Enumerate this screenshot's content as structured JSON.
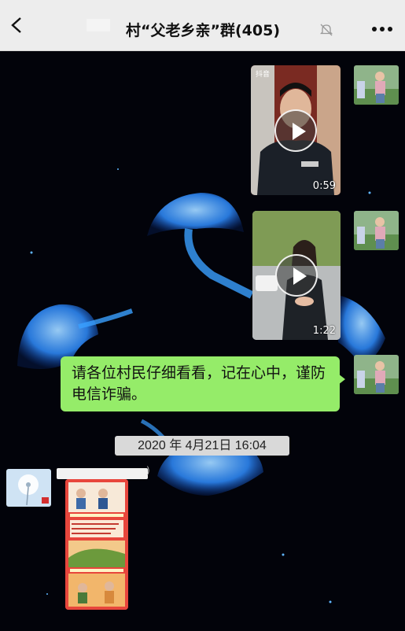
{
  "header": {
    "title": "村“父老乡亲”群(405)",
    "back_icon": "chevron-left-icon",
    "mute_icon": "bell-off-icon",
    "more_icon": "more-dots-icon"
  },
  "messages": {
    "video_1": {
      "duration": "0:59",
      "watermark": "抖音"
    },
    "video_2": {
      "duration": "1:22"
    },
    "text_message": "请各位村民仔细看看，记在心中，谨防电信诈骗。",
    "timestamp": "2020 年 4月21日 16:04",
    "sender_name_suffix": ")"
  },
  "colors": {
    "header_bg": "#ededed",
    "chat_bg": "#02030a",
    "bubble_green": "#95ec69",
    "jellyfish_blue": "#2f8dff",
    "poster_red": "#e8463c"
  }
}
